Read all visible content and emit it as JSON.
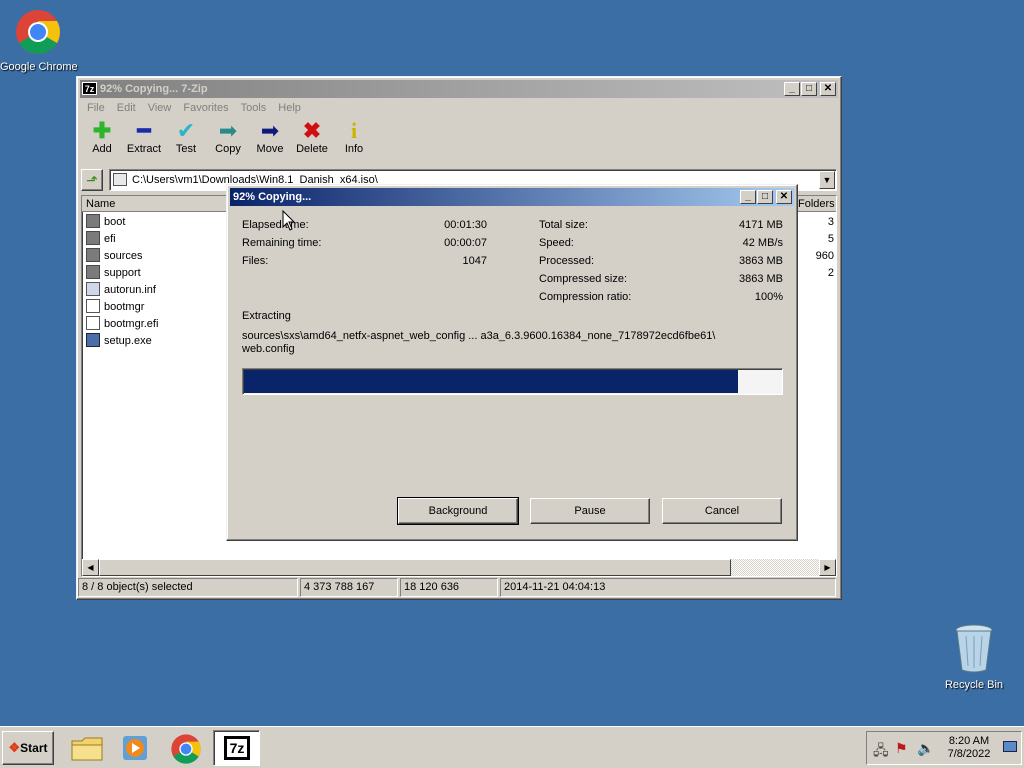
{
  "desktop": {
    "icons": [
      {
        "label": "Google Chrome",
        "icon": "chrome-icon"
      },
      {
        "label": "Recycle Bin",
        "icon": "recycle-bin-icon"
      }
    ]
  },
  "main_window": {
    "title": "92% Copying... 7-Zip",
    "menu": [
      "File",
      "Edit",
      "View",
      "Favorites",
      "Tools",
      "Help"
    ],
    "toolbar": [
      {
        "label": "Add",
        "icon": "add-icon"
      },
      {
        "label": "Extract",
        "icon": "extract-icon"
      },
      {
        "label": "Test",
        "icon": "test-icon"
      },
      {
        "label": "Copy",
        "icon": "copy-icon"
      },
      {
        "label": "Move",
        "icon": "move-icon"
      },
      {
        "label": "Delete",
        "icon": "delete-icon"
      },
      {
        "label": "Info",
        "icon": "info-icon"
      }
    ],
    "address": "C:\\Users\\vm1\\Downloads\\Win8.1_Danish_x64.iso\\",
    "columns": {
      "name": "Name",
      "folders": "Folders"
    },
    "files": [
      {
        "name": "boot",
        "type": "folder"
      },
      {
        "name": "efi",
        "type": "folder"
      },
      {
        "name": "sources",
        "type": "folder"
      },
      {
        "name": "support",
        "type": "folder"
      },
      {
        "name": "autorun.inf",
        "type": "inf"
      },
      {
        "name": "bootmgr",
        "type": "file"
      },
      {
        "name": "bootmgr.efi",
        "type": "file"
      },
      {
        "name": "setup.exe",
        "type": "exe"
      }
    ],
    "folders_col": [
      "3",
      "5",
      "960",
      "2"
    ],
    "status": {
      "selected": "8 / 8 object(s) selected",
      "size": "4 373 788 167",
      "packed": "18 120 636",
      "date": "2014-11-21 04:04:13"
    }
  },
  "dialog": {
    "title": "92% Copying...",
    "elapsed_label": "Elapsed time:",
    "elapsed_value": "00:01:30",
    "remaining_label": "Remaining time:",
    "remaining_value": "00:00:07",
    "files_label": "Files:",
    "files_value": "1047",
    "total_size_label": "Total size:",
    "total_size_value": "4171 MB",
    "speed_label": "Speed:",
    "speed_value": "42 MB/s",
    "processed_label": "Processed:",
    "processed_value": "3863 MB",
    "compressed_label": "Compressed size:",
    "compressed_value": "3863 MB",
    "ratio_label": "Compression ratio:",
    "ratio_value": "100%",
    "operation": "Extracting",
    "path_line1": "sources\\sxs\\amd64_netfx-aspnet_web_config ... a3a_6.3.9600.16384_none_7178972ecd6fbe61\\",
    "path_line2": "web.config",
    "progress": 0.92,
    "buttons": {
      "background": "Background",
      "pause": "Pause",
      "cancel": "Cancel"
    }
  },
  "taskbar": {
    "start": "Start",
    "time": "8:20 AM",
    "date": "7/8/2022"
  }
}
